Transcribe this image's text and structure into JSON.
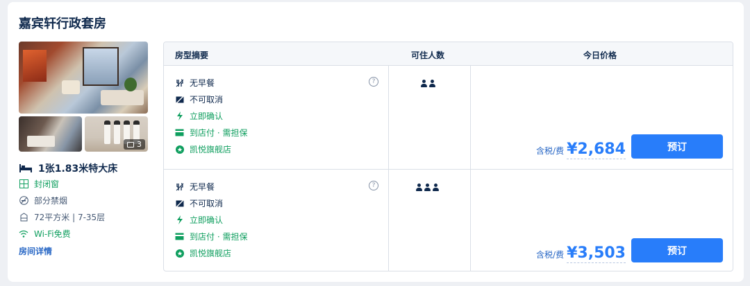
{
  "room": {
    "title": "嘉宾轩行政套房",
    "photo_count": "3",
    "bed": "1张1.83米特大床",
    "features": [
      {
        "icon": "window-icon",
        "label": "封闭窗",
        "tone": "green"
      },
      {
        "icon": "no-smoking-icon",
        "label": "部分禁烟",
        "tone": "gray"
      },
      {
        "icon": "area-icon",
        "label": "72平方米 | 7-35层",
        "tone": "gray"
      },
      {
        "icon": "wifi-icon",
        "label": "Wi-Fi免费",
        "tone": "green"
      }
    ],
    "details_link": "房间详情"
  },
  "table": {
    "headers": {
      "summary": "房型摘要",
      "occupancy": "可住人数",
      "price": "今日价格"
    },
    "rows": [
      {
        "perks": {
          "breakfast": "无早餐",
          "cancel": "不可取消",
          "confirm": "立即确认",
          "payment": "到店付 · 需担保",
          "store": "凯悦旗舰店"
        },
        "guests": 2,
        "tax_label": "含税/费",
        "price": "¥2,684",
        "book_label": "预订"
      },
      {
        "perks": {
          "breakfast": "无早餐",
          "cancel": "不可取消",
          "confirm": "立即确认",
          "payment": "到店付 · 需担保",
          "store": "凯悦旗舰店"
        },
        "guests": 3,
        "tax_label": "含税/费",
        "price": "¥3,503",
        "book_label": "预订"
      }
    ]
  },
  "colors": {
    "accent": "#287dfa",
    "green": "#0e9e5e",
    "text": "#0f294d"
  }
}
